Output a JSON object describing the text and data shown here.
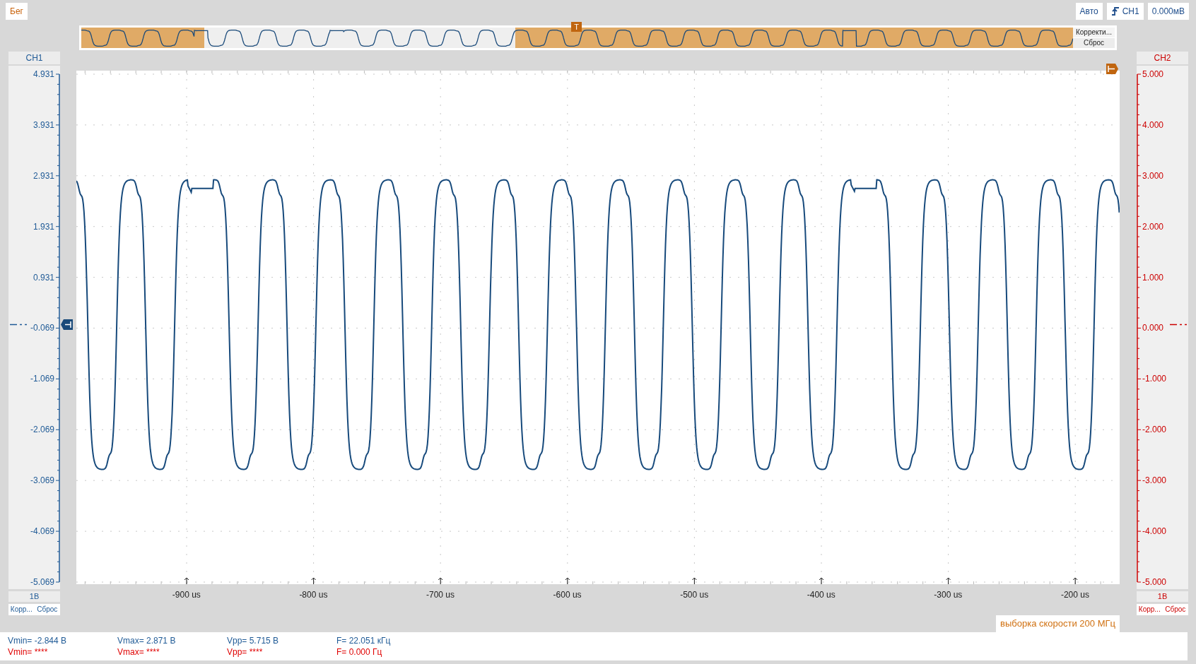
{
  "top_bar": {
    "run_button": "Бег",
    "mode_button": "Авто",
    "trigger_source": "CH1",
    "trigger_level": "0.000мВ"
  },
  "overview": {
    "trigger_marker": "T",
    "correct_button": "Корректи...",
    "reset_button": "Сброс"
  },
  "channels": [
    {
      "title": "CH1",
      "color": "#1f5a96",
      "labels": [
        "4.931",
        "3.931",
        "2.931",
        "1.931",
        "0.931",
        "-0.069",
        "-1.069",
        "-2.069",
        "-3.069",
        "-4.069",
        "-5.069"
      ],
      "scale": "1В",
      "correct_button": "Корр...",
      "reset_button": "Сброс"
    },
    {
      "title": "CH2",
      "color": "#cc0000",
      "labels": [
        "5.000",
        "4.000",
        "3.000",
        "2.000",
        "1.000",
        "0.000",
        "-1.000",
        "-2.000",
        "-3.000",
        "-4.000",
        "-5.000"
      ],
      "scale": "1В",
      "correct_button": "Корр...",
      "reset_button": "Сброс"
    }
  ],
  "time_axis": {
    "labels": [
      "-900 us",
      "-800 us",
      "-700 us",
      "-600 us",
      "-500 us",
      "-400 us",
      "-300 us",
      "-200 us"
    ]
  },
  "sample_rate": "выборка скорости 200 МГц",
  "measurements": [
    {
      "color": "#1f5a96",
      "items": [
        "Vmin= -2.844 В",
        "Vmax= 2.871 В",
        "Vpp= 5.715 В",
        "F= 22.051 кГц"
      ]
    },
    {
      "color": "#e00000",
      "items": [
        "Vmin= ****",
        "Vmax= ****",
        "Vpp= ****",
        "F= 0.000 Гц"
      ]
    }
  ]
}
